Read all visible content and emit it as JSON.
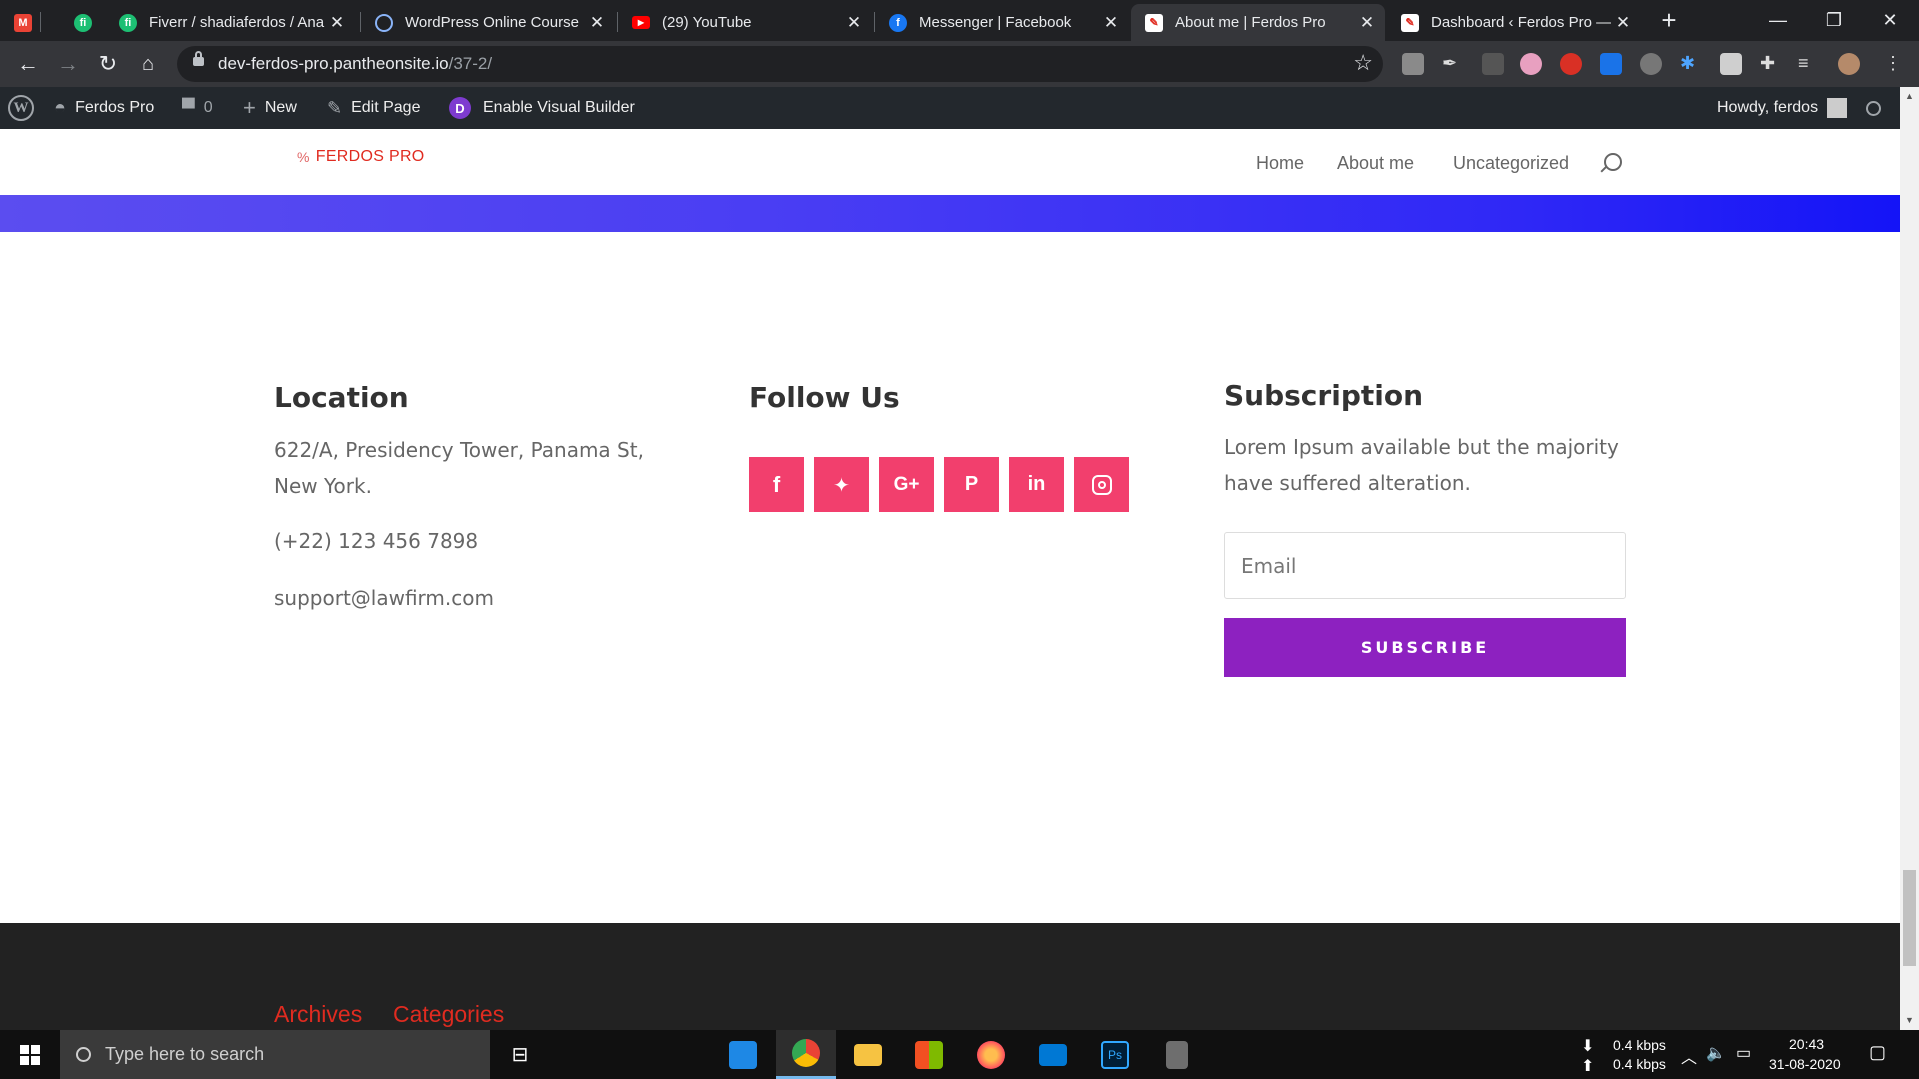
{
  "browser": {
    "tabs": [
      {
        "title": "",
        "icon": "gmail-icon",
        "color": "#ea4335"
      },
      {
        "title": "",
        "icon": "fiverr-icon",
        "color": "#1dbf73"
      },
      {
        "title": "Fiverr / shadiaferdos / Ana",
        "icon": "fiverr-icon",
        "color": "#1dbf73"
      },
      {
        "title": "WordPress Online Course",
        "icon": "wordpress-course-icon",
        "color": "#4285f4"
      },
      {
        "title": "(29) YouTube",
        "icon": "youtube-icon",
        "color": "#ff0000"
      },
      {
        "title": "Messenger | Facebook",
        "icon": "facebook-icon",
        "color": "#1877f2"
      },
      {
        "title": "About me | Ferdos Pro",
        "icon": "divi-page-icon",
        "color": "#e02b20"
      },
      {
        "title": "Dashboard ‹ Ferdos Pro —",
        "icon": "divi-page-icon",
        "color": "#e02b20"
      }
    ],
    "url_host": "dev-ferdos-pro.pantheonsite.io",
    "url_path": "/37-2/"
  },
  "wp_admin": {
    "site_name": "Ferdos Pro",
    "comments_count": "0",
    "new_label": "New",
    "edit_label": "Edit Page",
    "builder_label": "Enable Visual Builder",
    "builder_badge": "D",
    "howdy": "Howdy, ferdos"
  },
  "site": {
    "logo_text": "FERDOS PRO",
    "nav": [
      "Home",
      "About me",
      "Uncategorized"
    ]
  },
  "location": {
    "title": "Location",
    "address_line1": "622/A, Presidency Tower, Panama St,",
    "address_line2": "New York.",
    "phone": "(+22) 123 456 7898",
    "email": "support@lawfirm.com"
  },
  "follow": {
    "title": "Follow Us",
    "icons": [
      {
        "glyph": "f",
        "name": "facebook"
      },
      {
        "glyph": "🐦",
        "name": "twitter"
      },
      {
        "glyph": "G+",
        "name": "google-plus"
      },
      {
        "glyph": "P",
        "name": "pinterest"
      },
      {
        "glyph": "in",
        "name": "linkedin"
      },
      {
        "glyph": "◎",
        "name": "instagram"
      }
    ],
    "color": "#f23f6d"
  },
  "subscription": {
    "title": "Subscription",
    "text_line1": "Lorem Ipsum available but the majority",
    "text_line2": "have suffered alteration.",
    "email_placeholder": "Email",
    "button_label": "SUBSCRIBE",
    "button_color": "#8d21c0"
  },
  "footer": {
    "archives": "Archives",
    "categories": "Categories"
  },
  "taskbar": {
    "search_placeholder": "Type here to search",
    "net_down": "0.4 kbps",
    "net_up": "0.4 kbps",
    "time": "20:43",
    "date": "31-08-2020"
  }
}
